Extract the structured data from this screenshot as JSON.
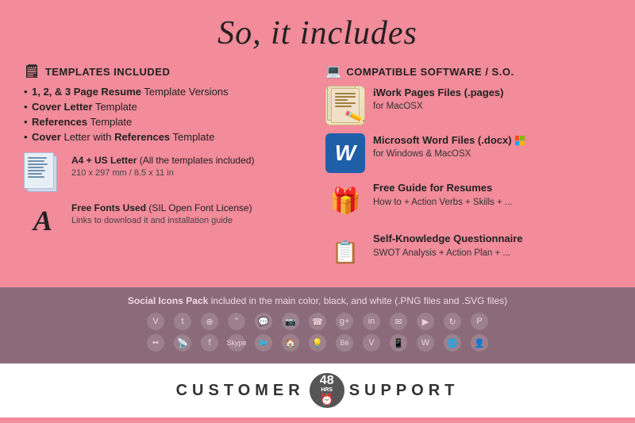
{
  "page": {
    "title": "So, it includes",
    "background_color": "#f28b9a"
  },
  "left": {
    "templates_header": "TEMPLATES INCLUDED",
    "templates_icon": "🗒",
    "template_items": [
      {
        "bold": "1, 2, & 3 Page Resume",
        "rest": " Template Versions"
      },
      {
        "bold": "Cover Letter",
        "rest": " Template"
      },
      {
        "bold": "References",
        "rest": " Template"
      },
      {
        "bold": "Cover",
        "rest": " Letter with ",
        "bold2": "References",
        "rest2": " Template"
      }
    ],
    "a4_icon_label": "A4 doc",
    "a4_title": "A4 + US Letter",
    "a4_desc": "(All the templates included)",
    "a4_size": "210 x 297 mm / 8.5 x 11 in",
    "fonts_icon_label": "A",
    "fonts_title": "Free Fonts Used",
    "fonts_desc": "(SIL Open Font License)",
    "fonts_sub": "Links to download it and installation guide"
  },
  "right": {
    "software_header": "COMPATIBLE SOFTWARE / S.O.",
    "software_icon": "💻",
    "iwork_title": "iWork Pages Files (.pages)",
    "iwork_platform": "for MacOSX",
    "word_title": "Microsoft Word Files (.docx)",
    "word_platform": "for Windows & MacOSX",
    "guide_title": "Free Guide for Resumes",
    "guide_desc": "How to + Action Verbs + Skills + ...",
    "swot_title": "Self-Knowledge Questionnaire",
    "swot_desc": "SWOT Analysis + Action Plan + ..."
  },
  "bottom": {
    "social_label_bold": "Social Icons Pack",
    "social_label_rest": " included in the main color, black, and white (.PNG files and .SVG files)",
    "social_icons": [
      "v",
      "t",
      "⊕",
      "❝",
      "💬",
      "📷",
      "☎",
      "g+",
      "in",
      "✉",
      "▶",
      "↻",
      "P",
      "••",
      "📡",
      "f",
      "Skype",
      "🐦",
      "🏠",
      "💡",
      "Bé",
      "V",
      "📱",
      "W",
      "🌐",
      "👤"
    ],
    "customer_support_left": "CUSTOMER",
    "customer_support_right": "SUPPORT",
    "badge_number": "48",
    "badge_hours": "HRS"
  }
}
